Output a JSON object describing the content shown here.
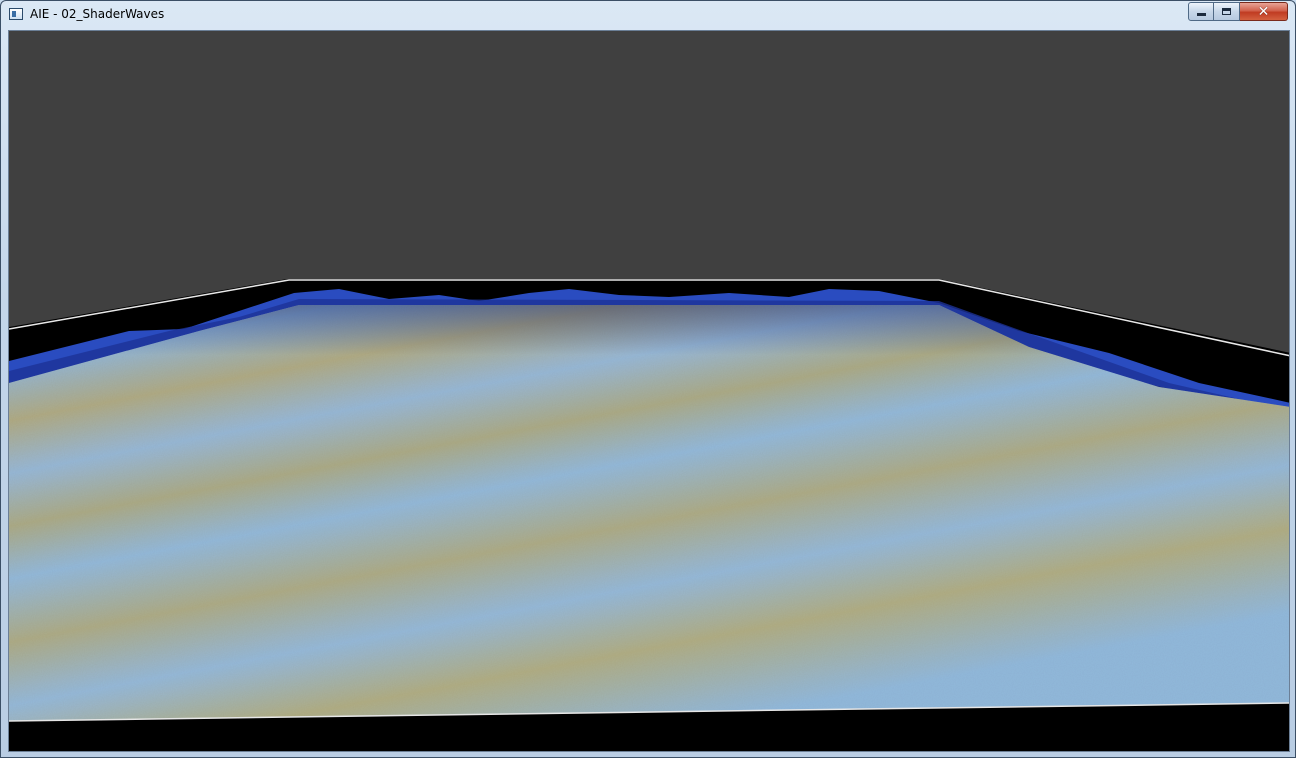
{
  "window": {
    "title": "AIE - 02_ShaderWaves",
    "icon": "app-window-icon",
    "controls": {
      "minimize": "minimize-icon",
      "maximize": "maximize-icon",
      "close_label": "✕"
    }
  },
  "scene": {
    "background_color": "#404040",
    "ground_color": "#000000",
    "grid_line_color": "#ffffff",
    "wave_surface_colors": [
      "#8fb0cf",
      "#a9a37e",
      "#2a47b8"
    ]
  }
}
